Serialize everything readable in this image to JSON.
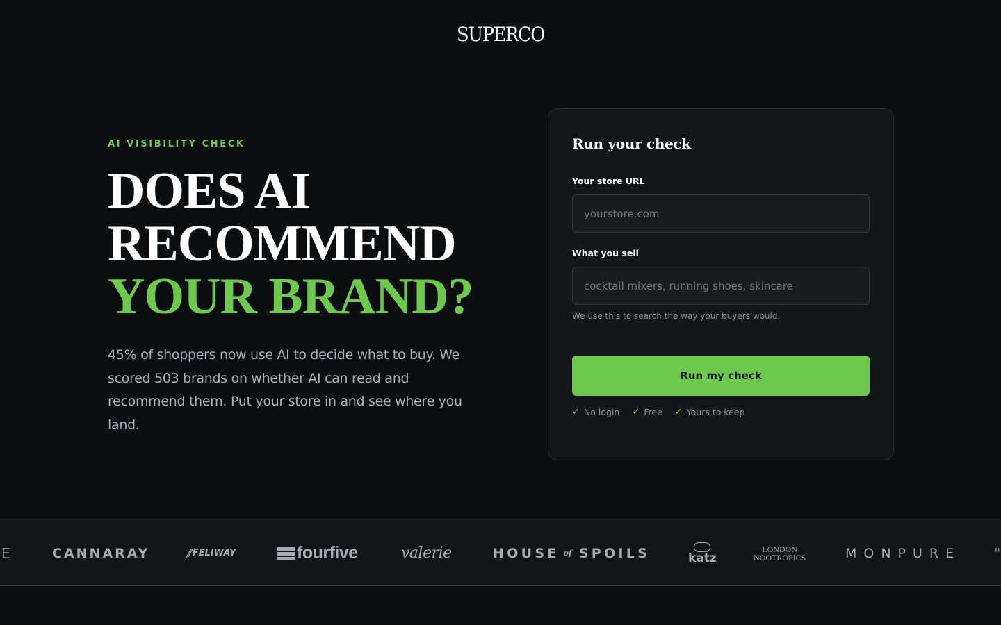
{
  "header": {
    "logo": "SUPERCO"
  },
  "hero": {
    "eyebrow": "AI VISIBILITY CHECK",
    "headline_line1": "DOES AI",
    "headline_line2": "RECOMMEND",
    "headline_line3": "YOUR BRAND?",
    "lede": "45% of shoppers now use AI to decide what to buy. We scored 503 brands on whether AI can read and recommend them. Put your store in and see where you land."
  },
  "form": {
    "title": "Run your check",
    "url_label": "Your store URL",
    "url_placeholder": "yourstore.com",
    "url_value": "",
    "sell_label": "What you sell",
    "sell_placeholder": "cocktail mixers, running shoes, skincare",
    "sell_value": "",
    "sell_help": "We use this to search the way your buyers would.",
    "submit_label": "Run my check",
    "perks": [
      "No login",
      "Free",
      "Yours to keep"
    ],
    "check_glyph": "✓"
  },
  "logos": {
    "partial_left": "E",
    "cannaray": "CANNARAY",
    "feliway_mark": "⫽",
    "feliway": "FELIWAY",
    "fourfive": "fourfive",
    "valerie": "valerie",
    "house_a": "HOUSE",
    "house_of": "of",
    "house_b": "SPOILS",
    "katz": "katz",
    "london_a": "LONDON",
    "london_b": "NOOTROPICS",
    "monpure": "MONPURE",
    "partial_right": "\""
  },
  "colors": {
    "background": "#0b0d0f",
    "accent": "#6cc94c",
    "card": "#121618",
    "muted_text": "#a7b0ba"
  }
}
